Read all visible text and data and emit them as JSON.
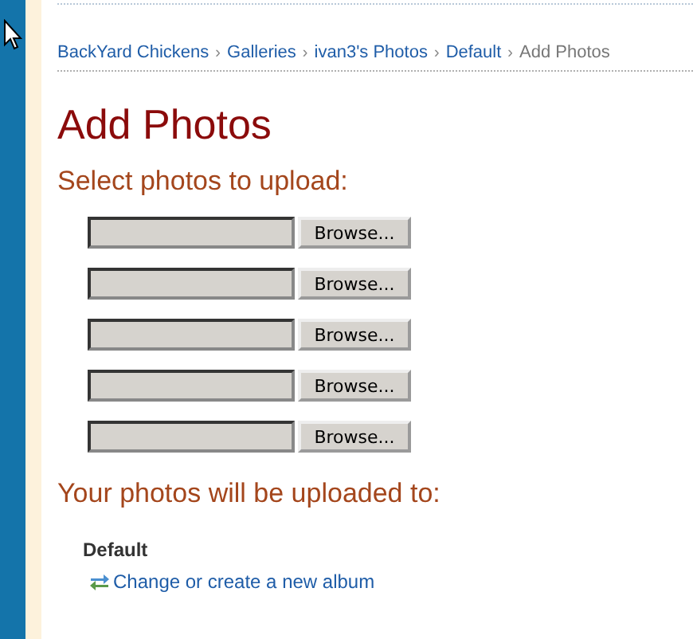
{
  "breadcrumb": [
    {
      "label": "BackYard Chickens",
      "current": false
    },
    {
      "label": "Galleries",
      "current": false
    },
    {
      "label": "ivan3's Photos",
      "current": false
    },
    {
      "label": "Default",
      "current": false
    },
    {
      "label": "Add Photos",
      "current": true
    }
  ],
  "breadcrumb_separator": "›",
  "title": "Add Photos",
  "upload_heading": "Select photos to upload:",
  "file_inputs": [
    {
      "button": "Browse..."
    },
    {
      "button": "Browse..."
    },
    {
      "button": "Browse..."
    },
    {
      "button": "Browse..."
    },
    {
      "button": "Browse..."
    }
  ],
  "destination_heading": "Your photos will be uploaded to:",
  "album": "Default",
  "change_link": "Change or create a new album"
}
